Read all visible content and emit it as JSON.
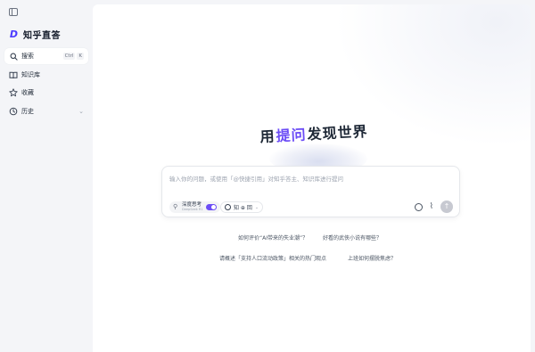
{
  "app": {
    "name": "知乎直答"
  },
  "sidebar": {
    "search": {
      "label": "搜索",
      "shortcut_key1": "Ctrl",
      "shortcut_key2": "K"
    },
    "items": [
      {
        "label": "知识库",
        "icon": "book-icon"
      },
      {
        "label": "收藏",
        "icon": "star-icon"
      },
      {
        "label": "历史",
        "icon": "history-icon"
      }
    ]
  },
  "hero": {
    "prefix": "用",
    "accent": "提问",
    "suffix": "发现世界"
  },
  "input": {
    "placeholder": "输入你的问题，或使用「@快捷引用」对知乎答主、知识库进行提问",
    "deep_think_label": "深度思考",
    "deep_think_sub": "DeepSeek R1",
    "deep_think_on": true,
    "sources_label": "知 ⊕ 回"
  },
  "suggestions": [
    "如何评价“AI带来的失业潮”？",
    "好看的武侠小说有哪些？",
    "请概述「支持人口流动政策」相关的热门观点",
    "上班如何摆脱焦虑？"
  ],
  "colors": {
    "accent": "#6c4df6",
    "sidebar_bg": "#f4f5f8",
    "main_bg": "#ffffff"
  }
}
